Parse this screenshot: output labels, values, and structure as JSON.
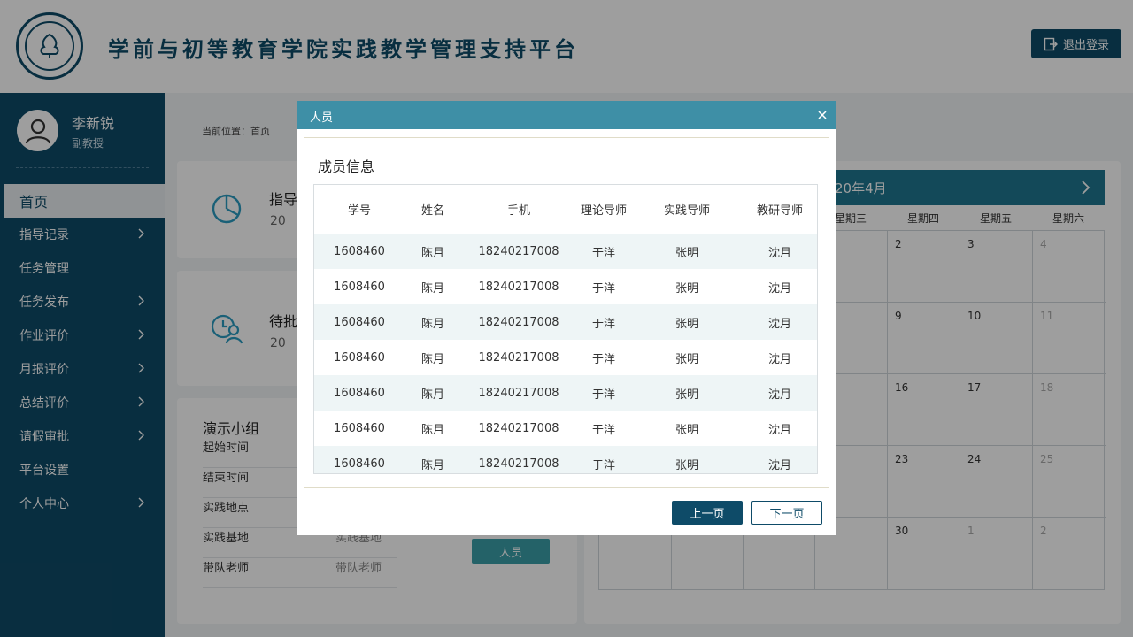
{
  "header": {
    "title": "学前与初等教育学院实践教学管理支持平台",
    "logout_label": "退出登录"
  },
  "sidebar": {
    "user_name": "李新锐",
    "user_role": "副教授",
    "items": [
      {
        "label": "首页"
      },
      {
        "label": "指导记录"
      },
      {
        "label": "任务管理"
      },
      {
        "label": "任务发布"
      },
      {
        "label": "作业评价"
      },
      {
        "label": "月报评价"
      },
      {
        "label": "总结评价"
      },
      {
        "label": "请假审批"
      },
      {
        "label": "平台设置"
      },
      {
        "label": "个人中心"
      }
    ]
  },
  "main": {
    "breadcrumb": "当前位置：首页",
    "stat1": {
      "title": "指导",
      "count": "20"
    },
    "stat2": {
      "title": "待批",
      "count": "20"
    },
    "group": {
      "title": "演示小组",
      "rows": [
        {
          "label": "起始时间",
          "value": ""
        },
        {
          "label": "结束时间",
          "value": ""
        },
        {
          "label": "实践地点",
          "value": ""
        },
        {
          "label": "实践基地",
          "value": "实践基地"
        },
        {
          "label": "带队老师",
          "value": "带队老师"
        }
      ],
      "member_button": "人员"
    },
    "calendar": {
      "month": "20年4月",
      "weekdays": [
        "星期三",
        "星期四",
        "星期五",
        "星期六"
      ],
      "days": [
        [
          "2",
          "3",
          "4"
        ],
        [
          "9",
          "10",
          "11"
        ],
        [
          "16",
          "17",
          "18"
        ],
        [
          "23",
          "24",
          "25"
        ],
        [
          "30",
          "1",
          "2"
        ]
      ]
    }
  },
  "modal": {
    "title": "人员",
    "panel_title": "成员信息",
    "columns": [
      "学号",
      "姓名",
      "手机",
      "理论导师",
      "实践导师",
      "教研导师"
    ],
    "rows": [
      [
        "1608460",
        "陈月",
        "18240217008",
        "于洋",
        "张明",
        "沈月"
      ],
      [
        "1608460",
        "陈月",
        "18240217008",
        "于洋",
        "张明",
        "沈月"
      ],
      [
        "1608460",
        "陈月",
        "18240217008",
        "于洋",
        "张明",
        "沈月"
      ],
      [
        "1608460",
        "陈月",
        "18240217008",
        "于洋",
        "张明",
        "沈月"
      ],
      [
        "1608460",
        "陈月",
        "18240217008",
        "于洋",
        "张明",
        "沈月"
      ],
      [
        "1608460",
        "陈月",
        "18240217008",
        "于洋",
        "张明",
        "沈月"
      ],
      [
        "1608460",
        "陈月",
        "18240217008",
        "于洋",
        "张明",
        "沈月"
      ]
    ],
    "prev_label": "上一页",
    "next_label": "下一页"
  },
  "colors": {
    "primary": "#0e4b68",
    "modal_header": "#3e8fa6",
    "calendar_header": "#1f7690",
    "row_stripe": "#eef5f6"
  }
}
